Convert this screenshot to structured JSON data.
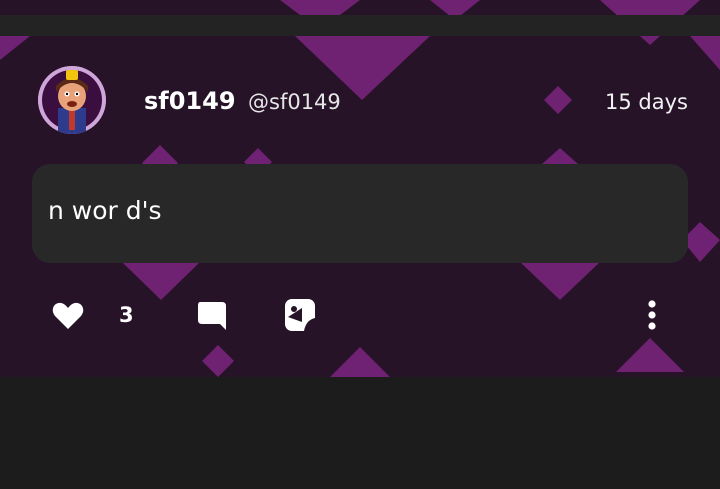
{
  "post": {
    "display_name": "sf0149",
    "handle": "@sf0149",
    "timestamp": "15 days",
    "message": "n wor d's",
    "like_count": "3"
  },
  "icons": {
    "avatar": "avatar-character",
    "like": "heart-icon",
    "comment": "comment-bubble-icon",
    "share": "share-sticker-icon",
    "more": "more-vertical-icon"
  },
  "colors": {
    "post_background": "#261328",
    "diamond_accent": "#8a2a8c",
    "bubble": "#282828",
    "page_background": "#1c1c1c",
    "text": "#ffffff"
  }
}
